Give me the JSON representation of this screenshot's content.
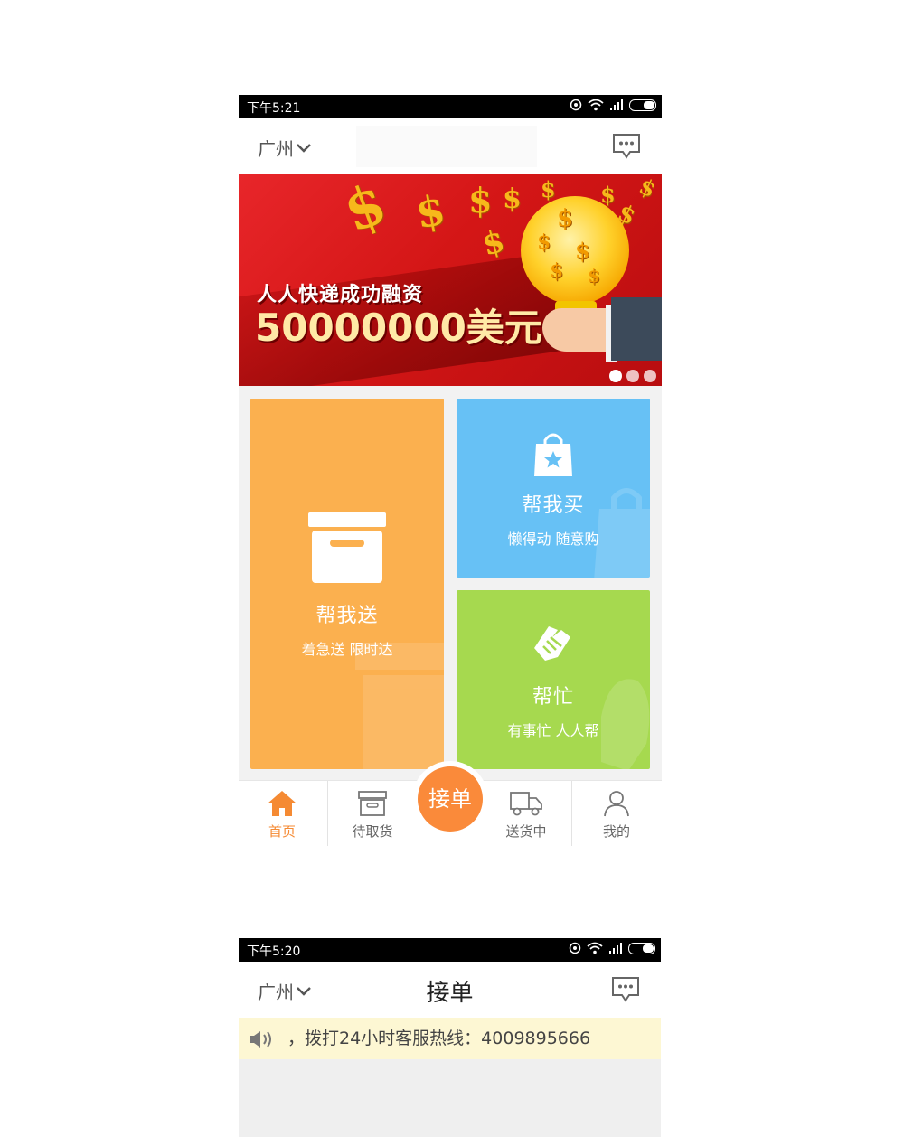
{
  "screen1": {
    "status_time": "下午5:21",
    "city": "广州",
    "banner": {
      "line1": "人人快递成功融资",
      "line2": "50000000美元"
    },
    "tiles": {
      "send": {
        "title": "帮我送",
        "subtitle": "着急送 限时达"
      },
      "buy": {
        "title": "帮我买",
        "subtitle": "懒得动 随意购"
      },
      "help": {
        "title": "帮忙",
        "subtitle": "有事忙 人人帮"
      }
    },
    "tabs": {
      "home": "首页",
      "pickup": "待取货",
      "center": "接单",
      "delivering": "送货中",
      "mine": "我的"
    }
  },
  "screen2": {
    "status_time": "下午5:20",
    "city": "广州",
    "title": "接单",
    "notice": "，拨打24小时客服热线：4009895666"
  },
  "colors": {
    "accent": "#fa8a3a",
    "send_tile": "#fbb04f",
    "buy_tile": "#67c1f5",
    "help_tile": "#a6d94f",
    "notice_bg": "#fdf7d3"
  }
}
